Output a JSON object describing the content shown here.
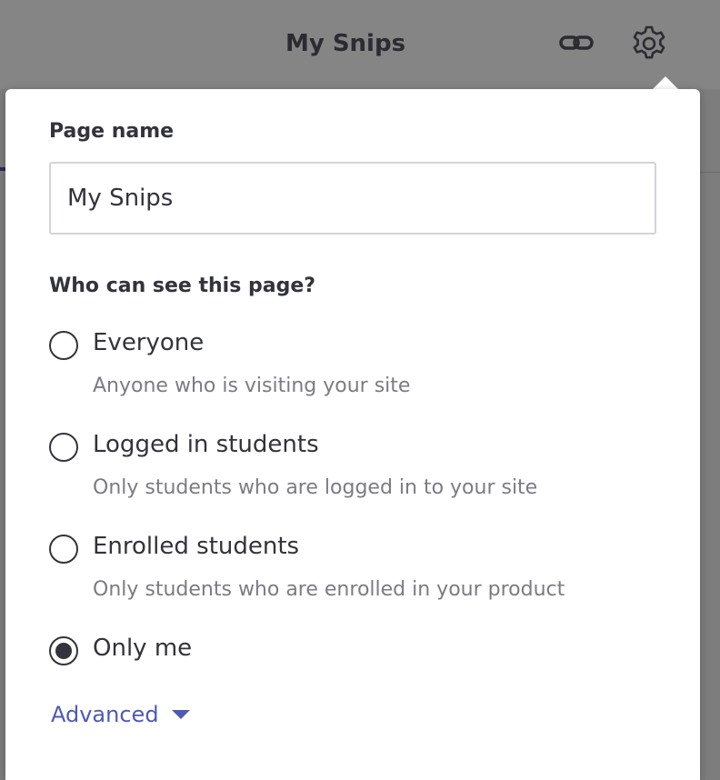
{
  "header": {
    "title": "My Snips",
    "link_icon": "link-icon",
    "settings_icon": "gear-icon"
  },
  "settings": {
    "page_name_label": "Page name",
    "page_name_value": "My Snips",
    "visibility_label": "Who can see this page?",
    "options": [
      {
        "label": "Everyone",
        "description": "Anyone who is visiting your site",
        "selected": false
      },
      {
        "label": "Logged in students",
        "description": "Only students who are logged in to your site",
        "selected": false
      },
      {
        "label": "Enrolled students",
        "description": "Only students who are enrolled in your product",
        "selected": false
      },
      {
        "label": "Only me",
        "description": "",
        "selected": true
      }
    ],
    "advanced_label": "Advanced",
    "advanced_icon": "caret-down-icon"
  },
  "colors": {
    "accent": "#4d5ab4",
    "text": "#33333d",
    "muted": "#7b7b86",
    "overlay": "#7d7d7d"
  }
}
